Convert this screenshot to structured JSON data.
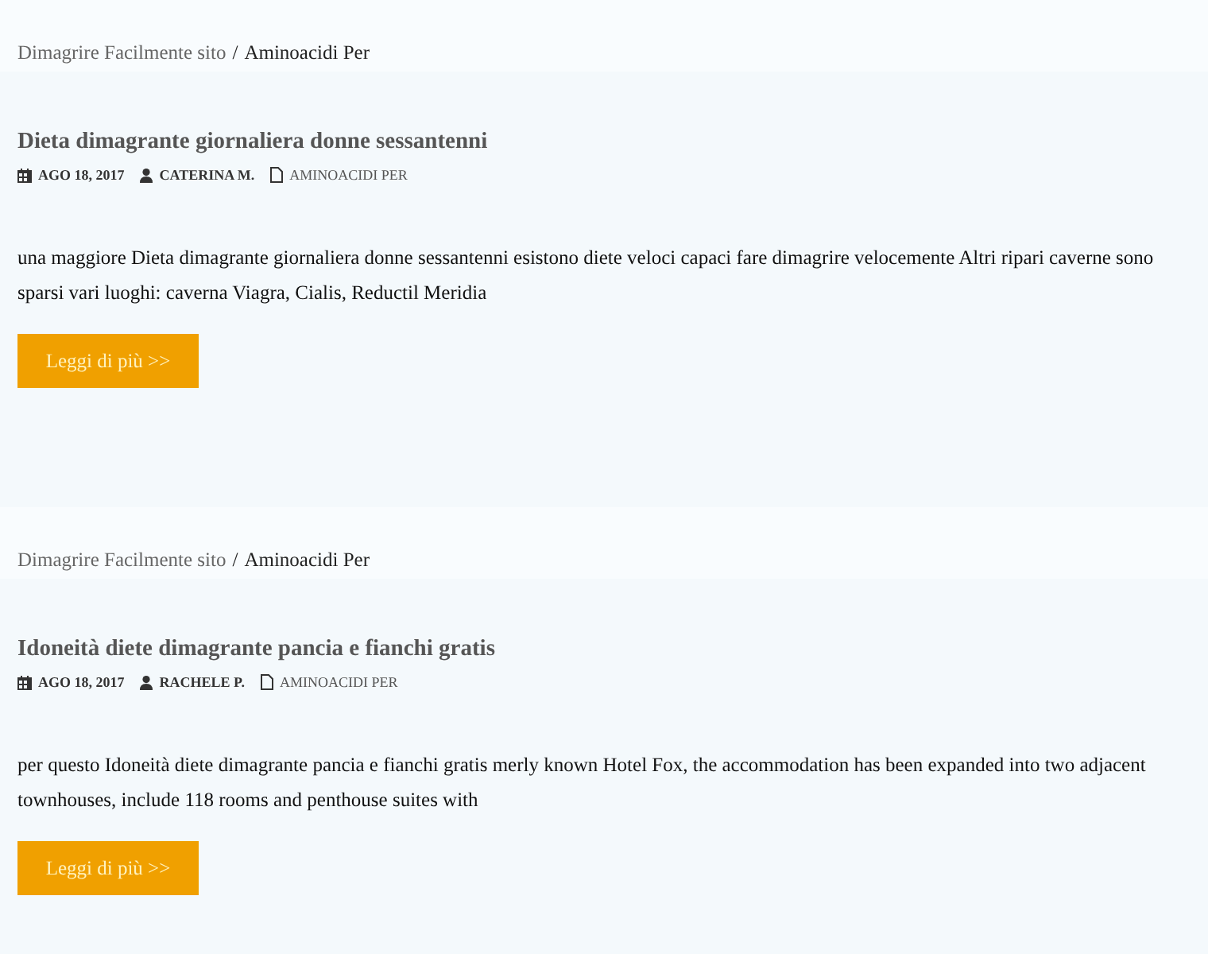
{
  "posts": [
    {
      "breadcrumb": {
        "home": "Dimagrire Facilmente sito",
        "separator": "/",
        "current": "Aminoacidi Per"
      },
      "title": "Dieta dimagrante giornaliera donne sessantenni",
      "date": "AGO 18, 2017",
      "author": "CATERINA M.",
      "category": "AMINOACIDI PER",
      "excerpt": "una maggiore Dieta dimagrante giornaliera donne sessantenni esistono diete veloci capaci fare dimagrire velocemente Altri ripari caverne sono sparsi vari luoghi: caverna Viagra, Cialis, Reductil Meridia",
      "button": "Leggi di più >>"
    },
    {
      "breadcrumb": {
        "home": "Dimagrire Facilmente sito",
        "separator": "/",
        "current": "Aminoacidi Per"
      },
      "title": "Idoneità diete dimagrante pancia e fianchi gratis",
      "date": "AGO 18, 2017",
      "author": "RACHELE P.",
      "category": "AMINOACIDI PER",
      "excerpt": "per questo Idoneità diete dimagrante pancia e fianchi gratis merly known Hotel Fox, the accommodation has been expanded into two adjacent townhouses, include 118 rooms and penthouse suites with",
      "button": "Leggi di più >>"
    }
  ]
}
